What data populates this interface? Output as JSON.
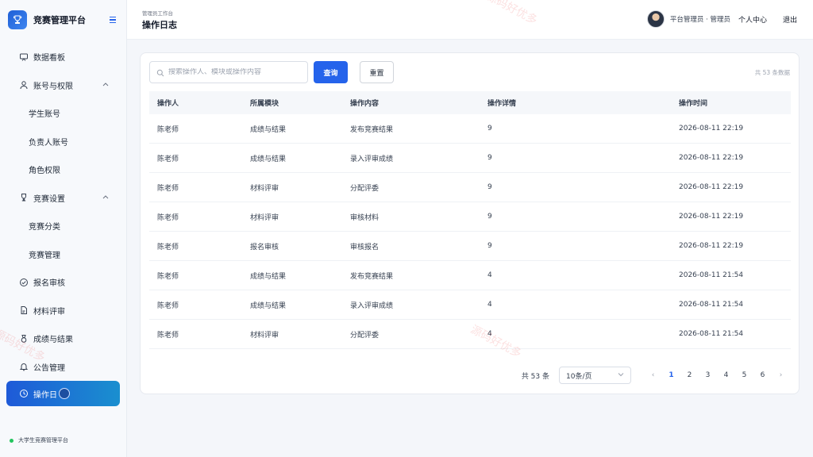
{
  "brand": {
    "title": "竞赛管理平台"
  },
  "sidebar": {
    "items": [
      {
        "label": "数据看板"
      },
      {
        "label": "账号与权限"
      },
      {
        "label": "学生账号"
      },
      {
        "label": "负责人账号"
      },
      {
        "label": "角色权限"
      },
      {
        "label": "竞赛设置"
      },
      {
        "label": "竞赛分类"
      },
      {
        "label": "竞赛管理"
      },
      {
        "label": "报名审核"
      },
      {
        "label": "材料评审"
      },
      {
        "label": "成绩与结果"
      },
      {
        "label": "公告管理"
      },
      {
        "label": "操作日"
      }
    ],
    "footer": "大学生竞赛管理平台"
  },
  "header": {
    "breadcrumb": "管理员工作台",
    "title": "操作日志",
    "user_role": "平台管理员 · 管理员",
    "profile_link": "个人中心",
    "logout_link": "退出"
  },
  "toolbar": {
    "search_placeholder": "搜索操作人、模块或操作内容",
    "search_value": "",
    "query_label": "查询",
    "reset_label": "重置",
    "total_text": "共 53 条数据"
  },
  "table": {
    "headers": [
      "操作人",
      "所属模块",
      "操作内容",
      "操作详情",
      "操作时间"
    ],
    "rows": [
      [
        "陈老师",
        "成绩与结果",
        "发布竞赛结果",
        "9",
        "2026-08-11 22:19"
      ],
      [
        "陈老师",
        "成绩与结果",
        "录入评审成绩",
        "9",
        "2026-08-11 22:19"
      ],
      [
        "陈老师",
        "材料评审",
        "分配评委",
        "9",
        "2026-08-11 22:19"
      ],
      [
        "陈老师",
        "材料评审",
        "审核材料",
        "9",
        "2026-08-11 22:19"
      ],
      [
        "陈老师",
        "报名审核",
        "审核报名",
        "9",
        "2026-08-11 22:19"
      ],
      [
        "陈老师",
        "成绩与结果",
        "发布竞赛结果",
        "4",
        "2026-08-11 21:54"
      ],
      [
        "陈老师",
        "成绩与结果",
        "录入评审成绩",
        "4",
        "2026-08-11 21:54"
      ],
      [
        "陈老师",
        "材料评审",
        "分配评委",
        "4",
        "2026-08-11 21:54"
      ]
    ]
  },
  "pagination": {
    "total": "共 53 条",
    "page_size": "10条/页",
    "pages": [
      "1",
      "2",
      "3",
      "4",
      "5",
      "6"
    ],
    "current": "1",
    "prev": "‹",
    "next": "›"
  },
  "colors": {
    "accent": "#2563eb",
    "active_nav_start": "#1e5ad8",
    "active_nav_end": "#1a8fcf"
  },
  "watermarks": [
    "源码好优多",
    "源码好优多",
    "源码好优多"
  ]
}
